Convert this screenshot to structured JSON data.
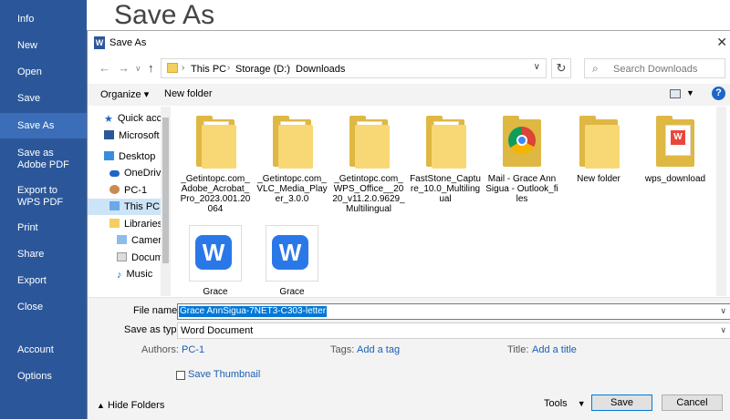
{
  "backstage": {
    "items": [
      {
        "label": "Info"
      },
      {
        "label": "New"
      },
      {
        "label": "Open"
      },
      {
        "label": "Save"
      },
      {
        "label": "Save As"
      },
      {
        "label": "Save as Adobe PDF"
      },
      {
        "label": "Export to WPS PDF"
      },
      {
        "label": "Print"
      },
      {
        "label": "Share"
      },
      {
        "label": "Export"
      },
      {
        "label": "Close"
      },
      {
        "label": "Account"
      },
      {
        "label": "Options"
      }
    ],
    "page_title": "Save As",
    "accent": "#2b579a"
  },
  "dialog": {
    "title": "Save As",
    "title_icon": "W",
    "close_glyph": "✕",
    "breadcrumbs": [
      "This PC",
      "Storage (D:)",
      "Downloads"
    ],
    "search_placeholder": "Search Downloads",
    "toolbar": {
      "organize": "Organize ▾",
      "new_folder": "New folder",
      "help": "?"
    },
    "nav_items": [
      {
        "label": "Quick access",
        "icon": "star-icon"
      },
      {
        "label": "Microsoft Word",
        "icon": "word-icon"
      },
      {
        "label": "Desktop",
        "icon": "desktop-icon"
      },
      {
        "label": "OneDrive",
        "icon": "cloud-icon"
      },
      {
        "label": "PC-1",
        "icon": "user-icon"
      },
      {
        "label": "This PC",
        "icon": "computer-icon"
      },
      {
        "label": "Libraries",
        "icon": "library-icon"
      },
      {
        "label": "Camera Roll",
        "icon": "folder-icon"
      },
      {
        "label": "Documents",
        "icon": "folder-icon"
      },
      {
        "label": "Music",
        "icon": "music-icon"
      }
    ],
    "files": [
      {
        "label": "_Getintopc.com_Adobe_Acrobat_Pro_2023.001.20064",
        "kind": "folder"
      },
      {
        "label": "_Getintopc.com_VLC_Media_Player_3.0.0",
        "kind": "folder"
      },
      {
        "label": "_Getintopc.com_WPS_Office__2020_v11.2.0.9629_Multilingual",
        "kind": "folder"
      },
      {
        "label": "FastStone_Capture_10.0_Multilingual",
        "kind": "folder"
      },
      {
        "label": "Mail - Grace Ann Sigua - Outlook_files",
        "kind": "folder"
      },
      {
        "label": "New folder",
        "kind": "folder"
      },
      {
        "label": "wps_download",
        "kind": "folder"
      },
      {
        "label": "Grace",
        "kind": "doc"
      },
      {
        "label": "Grace",
        "kind": "doc"
      }
    ],
    "form": {
      "file_name_label": "File name:",
      "file_name_value": "Grace AnnSigua-7NET3-C303-letter",
      "save_as_type_label": "Save as type:",
      "save_as_type_value": "Word Document",
      "authors_label": "Authors:",
      "authors_value": "PC-1",
      "tags_label": "Tags:",
      "tags_value": "Add a tag",
      "title_label": "Title:",
      "title_value": "Add a title",
      "save_thumbnail_label": "Save Thumbnail",
      "hide_folders": "Hide Folders",
      "tools": "Tools",
      "save_button": "Save",
      "cancel_button": "Cancel"
    }
  }
}
